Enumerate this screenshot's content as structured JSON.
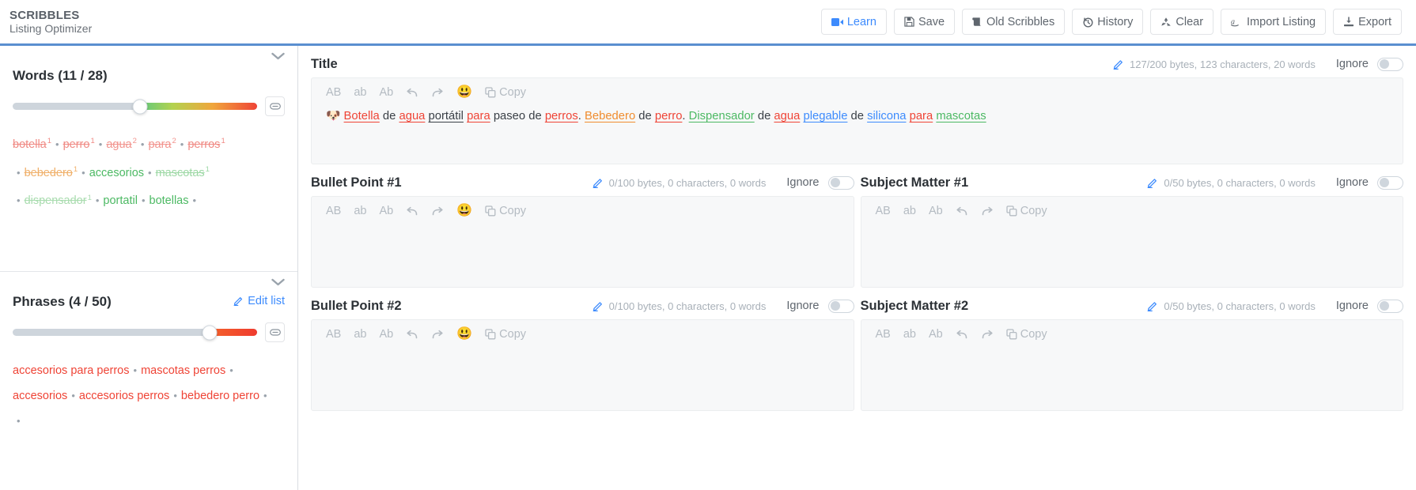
{
  "header": {
    "brand_title": "SCRIBBLES",
    "brand_subtitle": "Listing Optimizer",
    "buttons": [
      {
        "label": "Learn",
        "icon": "video-camera-icon"
      },
      {
        "label": "Save",
        "icon": "floppy-disk-icon"
      },
      {
        "label": "Old Scribbles",
        "icon": "scroll-icon"
      },
      {
        "label": "History",
        "icon": "clock-rotate-left-icon"
      },
      {
        "label": "Clear",
        "icon": "recycle-icon"
      },
      {
        "label": "Import Listing",
        "icon": "amazon-icon"
      },
      {
        "label": "Export",
        "icon": "download-icon"
      }
    ],
    "accent_color": "#3d8bfd",
    "rule_color": "#5b8fd0"
  },
  "sidebar": {
    "words_panel": {
      "title": "Words (11 / 28)",
      "slider_value_pct": 52,
      "link_icon": "link-icon",
      "caret_icon": "chevron-down-icon",
      "keywords": [
        {
          "text": "botella",
          "count": "1",
          "color": "#f08a84",
          "used": true
        },
        {
          "text": "perro",
          "count": "1",
          "color": "#f08a84",
          "used": true
        },
        {
          "text": "agua",
          "count": "2",
          "color": "#f2938d",
          "used": true
        },
        {
          "text": "para",
          "count": "2",
          "color": "#f2938d",
          "used": true
        },
        {
          "text": "perros",
          "count": "1",
          "color": "#f08a84",
          "used": true
        },
        {
          "text": "bebedero",
          "count": "1",
          "color": "#f0b06a",
          "used": true
        },
        {
          "text": "accesorios",
          "count": "",
          "color": "#4cb963",
          "used": false
        },
        {
          "text": "mascotas",
          "count": "1",
          "color": "#9dd8a5",
          "used": true
        },
        {
          "text": "dispensador",
          "count": "1",
          "color": "#a9dcaf",
          "used": true
        },
        {
          "text": "portatil",
          "count": "",
          "color": "#4cb963",
          "used": false
        },
        {
          "text": "botellas",
          "count": "",
          "color": "#4cb963",
          "used": false
        }
      ]
    },
    "phrases_panel": {
      "title": "Phrases (4 / 50)",
      "edit_list_label": "Edit list",
      "edit_list_icon": "pencil-icon",
      "slider_value_pct": 80.5,
      "link_icon": "link-icon",
      "caret_icon": "chevron-down-icon",
      "rows": [
        [
          {
            "text": "accesorios para perros",
            "color": "#ef4436"
          },
          {
            "text": "mascotas perros",
            "color": "#ef4436"
          }
        ],
        [
          {
            "text": "accesorios",
            "color": "#ef4436"
          },
          {
            "text": "accesorios perros",
            "color": "#ef4436"
          },
          {
            "text": "bebedero perro",
            "color": "#ef4436"
          }
        ]
      ]
    }
  },
  "editor_toolbar": {
    "uppercase": "AB",
    "lowercase": "ab",
    "titlecase": "Ab",
    "undo_icon": "undo-arrow-icon",
    "redo_icon": "redo-arrow-icon",
    "emoji_icon": "smiley-face-icon",
    "copy_label": "Copy",
    "copy_icon": "copy-icon"
  },
  "main": {
    "title_card": {
      "title": "Title",
      "counter": "127/200 bytes, 123 characters, 20 words",
      "pencil_icon": "pencil-icon",
      "ignore_label": "Ignore",
      "ignore_on": false,
      "content_tokens": [
        {
          "text": "🐶 ",
          "color": "#3a4047",
          "underline": false
        },
        {
          "text": "Botella",
          "color": "#ef4436",
          "underline": true
        },
        {
          "text": " de ",
          "color": "#3a4047",
          "underline": false
        },
        {
          "text": "agua",
          "color": "#ef4436",
          "underline": true
        },
        {
          "text": " ",
          "color": "#3a4047",
          "underline": false
        },
        {
          "text": "portátil",
          "color": "#3a4047",
          "underline": true
        },
        {
          "text": " ",
          "color": "#3a4047",
          "underline": false
        },
        {
          "text": "para",
          "color": "#ef4436",
          "underline": true
        },
        {
          "text": " paseo de ",
          "color": "#3a4047",
          "underline": false
        },
        {
          "text": "perros",
          "color": "#ef4436",
          "underline": true
        },
        {
          "text": ". ",
          "color": "#3a4047",
          "underline": false
        },
        {
          "text": "Bebedero",
          "color": "#f08c2e",
          "underline": true
        },
        {
          "text": " de ",
          "color": "#3a4047",
          "underline": false
        },
        {
          "text": "perro",
          "color": "#ef4436",
          "underline": true
        },
        {
          "text": ". ",
          "color": "#3a4047",
          "underline": false
        },
        {
          "text": "Dispensador",
          "color": "#4cb963",
          "underline": true
        },
        {
          "text": " de ",
          "color": "#3a4047",
          "underline": false
        },
        {
          "text": "agua",
          "color": "#ef4436",
          "underline": true
        },
        {
          "text": " ",
          "color": "#3a4047",
          "underline": false
        },
        {
          "text": "plegable",
          "color": "#3d8bfd",
          "underline": true
        },
        {
          "text": " de ",
          "color": "#3a4047",
          "underline": false
        },
        {
          "text": "silicona",
          "color": "#3d8bfd",
          "underline": true
        },
        {
          "text": " ",
          "color": "#3a4047",
          "underline": false
        },
        {
          "text": "para",
          "color": "#ef4436",
          "underline": true
        },
        {
          "text": " ",
          "color": "#3a4047",
          "underline": false
        },
        {
          "text": "mascotas",
          "color": "#4cb963",
          "underline": true
        }
      ]
    },
    "bullet_cards": [
      {
        "title": "Bullet Point #1",
        "counter": "0/100 bytes, 0 characters, 0 words",
        "pencil_icon": "pencil-icon",
        "ignore_label": "Ignore",
        "ignore_on": false,
        "content": ""
      },
      {
        "title": "Bullet Point #2",
        "counter": "0/100 bytes, 0 characters, 0 words",
        "pencil_icon": "pencil-icon",
        "ignore_label": "Ignore",
        "ignore_on": false,
        "content": ""
      }
    ],
    "subject_cards": [
      {
        "title": "Subject Matter #1",
        "counter": "0/50 bytes, 0 characters, 0 words",
        "pencil_icon": "pencil-icon",
        "ignore_label": "Ignore",
        "ignore_on": false,
        "content": ""
      },
      {
        "title": "Subject Matter #2",
        "counter": "0/50 bytes, 0 characters, 0 words",
        "pencil_icon": "pencil-icon",
        "ignore_label": "Ignore",
        "ignore_on": false,
        "content": ""
      }
    ]
  }
}
